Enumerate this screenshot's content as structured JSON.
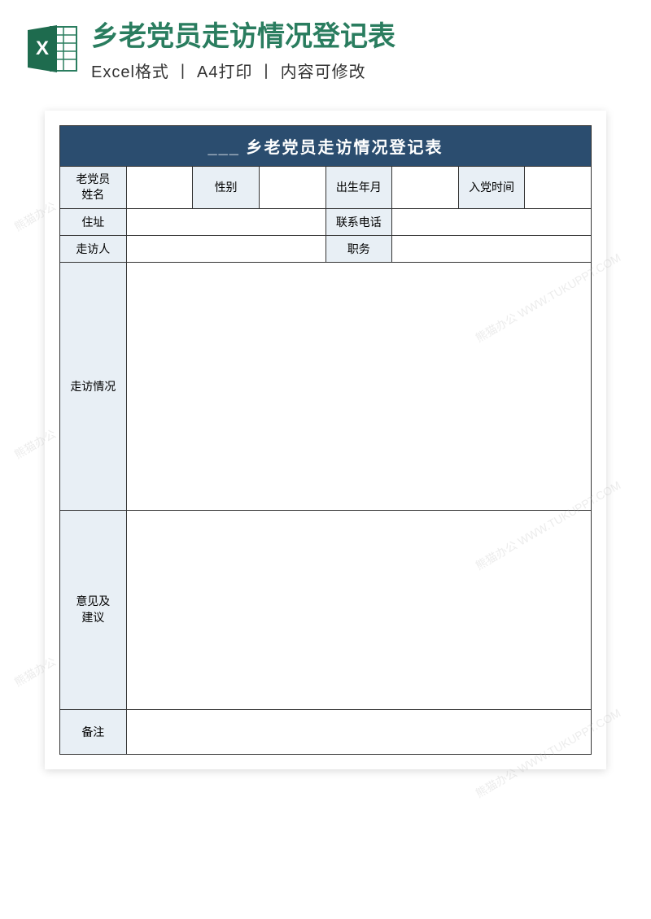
{
  "header": {
    "title": "乡老党员走访情况登记表",
    "subtitle": "Excel格式 丨 A4打印 丨 内容可修改"
  },
  "form": {
    "table_title_prefix": "___",
    "table_title": "乡老党员走访情况登记表",
    "labels": {
      "name": "老党员\n姓名",
      "gender": "性别",
      "birth_date": "出生年月",
      "join_date": "入党时间",
      "address": "住址",
      "phone": "联系电话",
      "visitor": "走访人",
      "position": "职务",
      "visit_details": "走访情况",
      "suggestions": "意见及\n建议",
      "remarks": "备注"
    },
    "values": {
      "name": "",
      "gender": "",
      "birth_date": "",
      "join_date": "",
      "address": "",
      "phone": "",
      "visitor": "",
      "position": "",
      "visit_details": "",
      "suggestions": "",
      "remarks": ""
    }
  },
  "watermark": {
    "text_left": "熊猫办公",
    "text_right": "熊猫办公 WWW.TUKUPPT.COM"
  },
  "colors": {
    "title_green": "#2a7d5f",
    "header_blue": "#2b4d6f",
    "label_bg": "#e8eff5"
  }
}
